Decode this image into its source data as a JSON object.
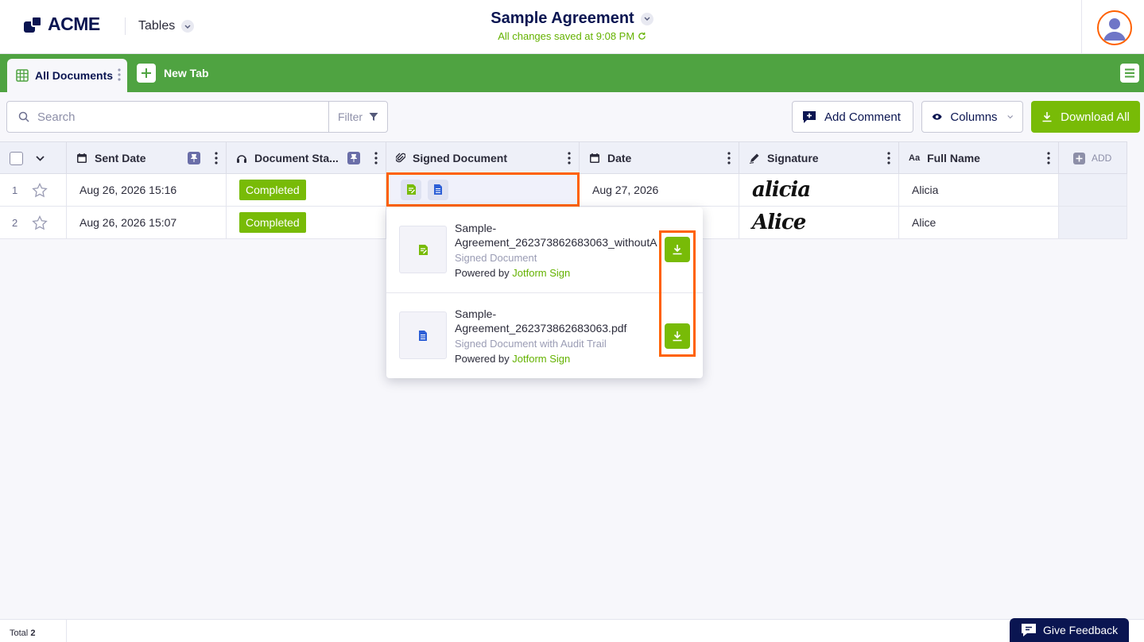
{
  "header": {
    "logo_text": "ACME",
    "app_switcher_label": "Tables",
    "document_title": "Sample Agreement",
    "save_status": "All changes saved at 9:08 PM"
  },
  "tabs": {
    "active_label": "All Documents",
    "new_tab_label": "New Tab"
  },
  "toolbar": {
    "search_placeholder": "Search",
    "filter_label": "Filter",
    "add_comment_label": "Add Comment",
    "columns_label": "Columns",
    "download_all_label": "Download All"
  },
  "table": {
    "columns": [
      {
        "label": "Sent Date",
        "icon": "calendar-icon",
        "pinned": true
      },
      {
        "label": "Document Sta...",
        "icon": "status-icon",
        "pinned": true
      },
      {
        "label": "Signed Document",
        "icon": "paperclip-icon",
        "pinned": false
      },
      {
        "label": "Date",
        "icon": "calendar-icon",
        "pinned": false
      },
      {
        "label": "Signature",
        "icon": "pen-icon",
        "pinned": false
      },
      {
        "label": "Full Name",
        "icon": "text-icon",
        "pinned": false
      }
    ],
    "text_icon_glyph": "Aa",
    "add_column_label": "ADD",
    "rows": [
      {
        "num": "1",
        "sent_date": "Aug 26, 2026 15:16",
        "status": "Completed",
        "date": "Aug 27, 2026",
        "signature": "alicia",
        "full_name": "Alicia"
      },
      {
        "num": "2",
        "sent_date": "Aug 26, 2026 15:07",
        "status": "Completed",
        "date": "",
        "signature": "Alice",
        "full_name": "Alice"
      }
    ]
  },
  "popup": {
    "files": [
      {
        "name_line1": "Sample-",
        "name_line2": "Agreement_262373862683063_withoutA",
        "type": "Signed Document",
        "powered_prefix": "Powered by ",
        "powered_brand": "Jotform Sign",
        "icon": "signed-doc-icon"
      },
      {
        "name_line1": "Sample-",
        "name_line2": "Agreement_262373862683063.pdf",
        "type": "Signed Document with Audit Trail",
        "powered_prefix": "Powered by ",
        "powered_brand": "Jotform Sign",
        "icon": "pdf-doc-icon"
      }
    ]
  },
  "footer": {
    "total_label": "Total",
    "total_count": "2",
    "feedback_label": "Give Feedback"
  },
  "colors": {
    "brand_navy": "#0a1551",
    "tab_green": "#4fa341",
    "action_green": "#78bb07",
    "highlight_orange": "#ff6100"
  }
}
